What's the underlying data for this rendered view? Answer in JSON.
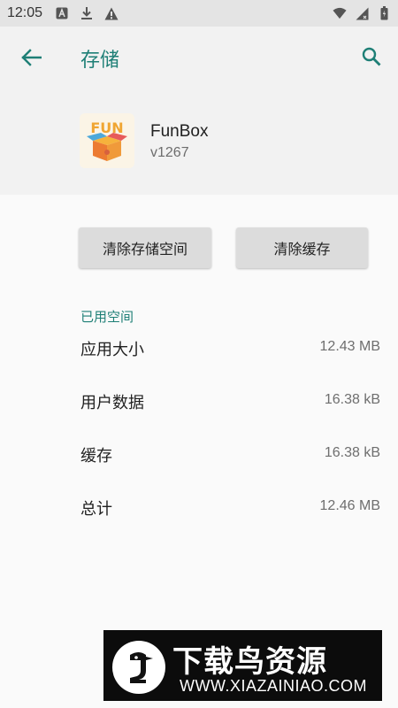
{
  "status_bar": {
    "time": "12:05",
    "left_icons": [
      "a-notification-icon",
      "download-icon",
      "warning-icon"
    ],
    "right_icons": [
      "wifi-icon",
      "signal-icon",
      "battery-icon"
    ]
  },
  "app_bar": {
    "title": "存储"
  },
  "app": {
    "name": "FunBox",
    "version": "v1267",
    "icon_text": "FUN"
  },
  "buttons": {
    "clear_storage": "清除存储空间",
    "clear_cache": "清除缓存"
  },
  "storage": {
    "section_title": "已用空间",
    "rows": [
      {
        "label": "应用大小",
        "value": "12.43 MB"
      },
      {
        "label": "用户数据",
        "value": "16.38 kB"
      },
      {
        "label": "缓存",
        "value": "16.38 kB"
      },
      {
        "label": "总计",
        "value": "12.46 MB"
      }
    ]
  },
  "watermark": {
    "title": "下载鸟资源",
    "url": "WWW.XIAZAINIAO.COM"
  },
  "colors": {
    "accent": "#1e7f76",
    "status_bar_bg": "#e4e4e4",
    "button_bg": "#dcdcdc"
  }
}
